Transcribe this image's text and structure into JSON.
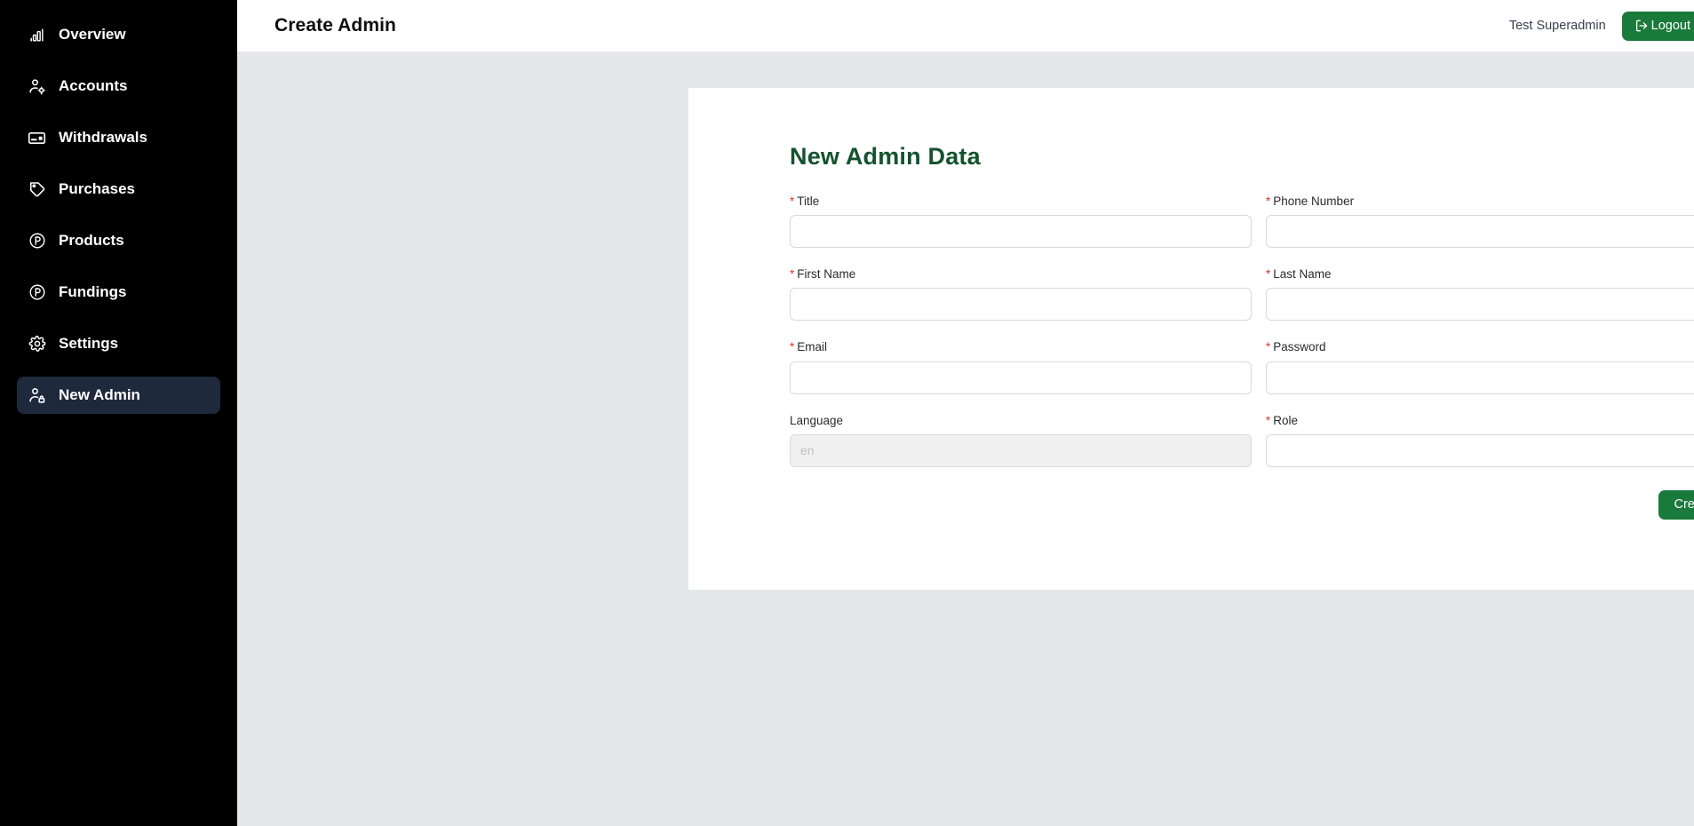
{
  "sidebar": {
    "items": [
      {
        "label": "Overview",
        "icon": "bar-chart-icon",
        "active": false
      },
      {
        "label": "Accounts",
        "icon": "user-gear-icon",
        "active": false
      },
      {
        "label": "Withdrawals",
        "icon": "credit-card-icon",
        "active": false
      },
      {
        "label": "Purchases",
        "icon": "tag-icon",
        "active": false
      },
      {
        "label": "Products",
        "icon": "circle-p-icon",
        "active": false
      },
      {
        "label": "Fundings",
        "icon": "circle-p-icon",
        "active": false
      },
      {
        "label": "Settings",
        "icon": "gear-icon",
        "active": false
      },
      {
        "label": "New Admin",
        "icon": "user-lock-icon",
        "active": true
      }
    ]
  },
  "topbar": {
    "title": "Create Admin",
    "user_name": "Test Superadmin",
    "logout_label": "Logout"
  },
  "form": {
    "heading": "New Admin Data",
    "fields": {
      "title": {
        "label": "Title",
        "required": true,
        "value": "",
        "placeholder": ""
      },
      "phone_number": {
        "label": "Phone Number",
        "required": true,
        "value": "",
        "placeholder": ""
      },
      "first_name": {
        "label": "First Name",
        "required": true,
        "value": "",
        "placeholder": ""
      },
      "last_name": {
        "label": "Last Name",
        "required": true,
        "value": "",
        "placeholder": ""
      },
      "email": {
        "label": "Email",
        "required": true,
        "value": "",
        "placeholder": ""
      },
      "password": {
        "label": "Password",
        "required": true,
        "value": "",
        "placeholder": ""
      },
      "language": {
        "label": "Language",
        "required": false,
        "value": "",
        "placeholder": "en"
      },
      "role": {
        "label": "Role",
        "required": true,
        "value": "",
        "placeholder": ""
      }
    },
    "submit_label": "Create"
  },
  "colors": {
    "brand_green": "#1a7a3c",
    "heading_green": "#14532d",
    "required_red": "#e03131",
    "sidebar_bg": "#000000",
    "sidebar_active_bg": "#1e293b",
    "page_bg": "#e5e7eb",
    "card_bg": "#ffffff"
  }
}
